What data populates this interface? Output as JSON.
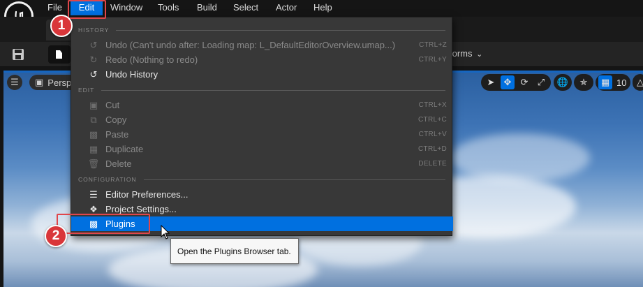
{
  "menubar": {
    "items": [
      {
        "label": "File",
        "active": false
      },
      {
        "label": "Edit",
        "active": true
      },
      {
        "label": "Window",
        "active": false
      },
      {
        "label": "Tools",
        "active": false
      },
      {
        "label": "Build",
        "active": false
      },
      {
        "label": "Select",
        "active": false
      },
      {
        "label": "Actor",
        "active": false
      },
      {
        "label": "Help",
        "active": false
      }
    ]
  },
  "toolbar": {
    "forms_partial_label": "forms"
  },
  "viewport": {
    "perspective_partial_label": "Persp",
    "grid_size": "10"
  },
  "edit_menu": {
    "sections": [
      {
        "header": "HISTORY",
        "items": [
          {
            "label": "Undo (Can't undo after: Loading map: L_DefaultEditorOverview.umap...)",
            "shortcut": "CTRL+Z",
            "icon": "undo-icon",
            "enabled": false
          },
          {
            "label": "Redo (Nothing to redo)",
            "shortcut": "CTRL+Y",
            "icon": "redo-icon",
            "enabled": false
          },
          {
            "label": "Undo History",
            "shortcut": "",
            "icon": "history-icon",
            "enabled": true
          }
        ]
      },
      {
        "header": "EDIT",
        "items": [
          {
            "label": "Cut",
            "shortcut": "CTRL+X",
            "icon": "cut-icon",
            "enabled": false
          },
          {
            "label": "Copy",
            "shortcut": "CTRL+C",
            "icon": "copy-icon",
            "enabled": false
          },
          {
            "label": "Paste",
            "shortcut": "CTRL+V",
            "icon": "paste-icon",
            "enabled": false
          },
          {
            "label": "Duplicate",
            "shortcut": "CTRL+D",
            "icon": "duplicate-icon",
            "enabled": false
          },
          {
            "label": "Delete",
            "shortcut": "DELETE",
            "icon": "trash-icon",
            "enabled": false
          }
        ]
      },
      {
        "header": "CONFIGURATION",
        "items": [
          {
            "label": "Editor Preferences...",
            "shortcut": "",
            "icon": "sliders-icon",
            "enabled": true
          },
          {
            "label": "Project Settings...",
            "shortcut": "",
            "icon": "cubes-icon",
            "enabled": true
          },
          {
            "label": "Plugins",
            "shortcut": "",
            "icon": "plug-icon",
            "enabled": true,
            "highlighted": true
          }
        ]
      }
    ]
  },
  "tooltip": {
    "text": "Open the Plugins Browser tab."
  },
  "annotations": {
    "badge_1": "1",
    "badge_2": "2"
  },
  "colors": {
    "accent": "#0070e0",
    "annotation_red": "#d9363a",
    "menu_bg": "#383838"
  }
}
